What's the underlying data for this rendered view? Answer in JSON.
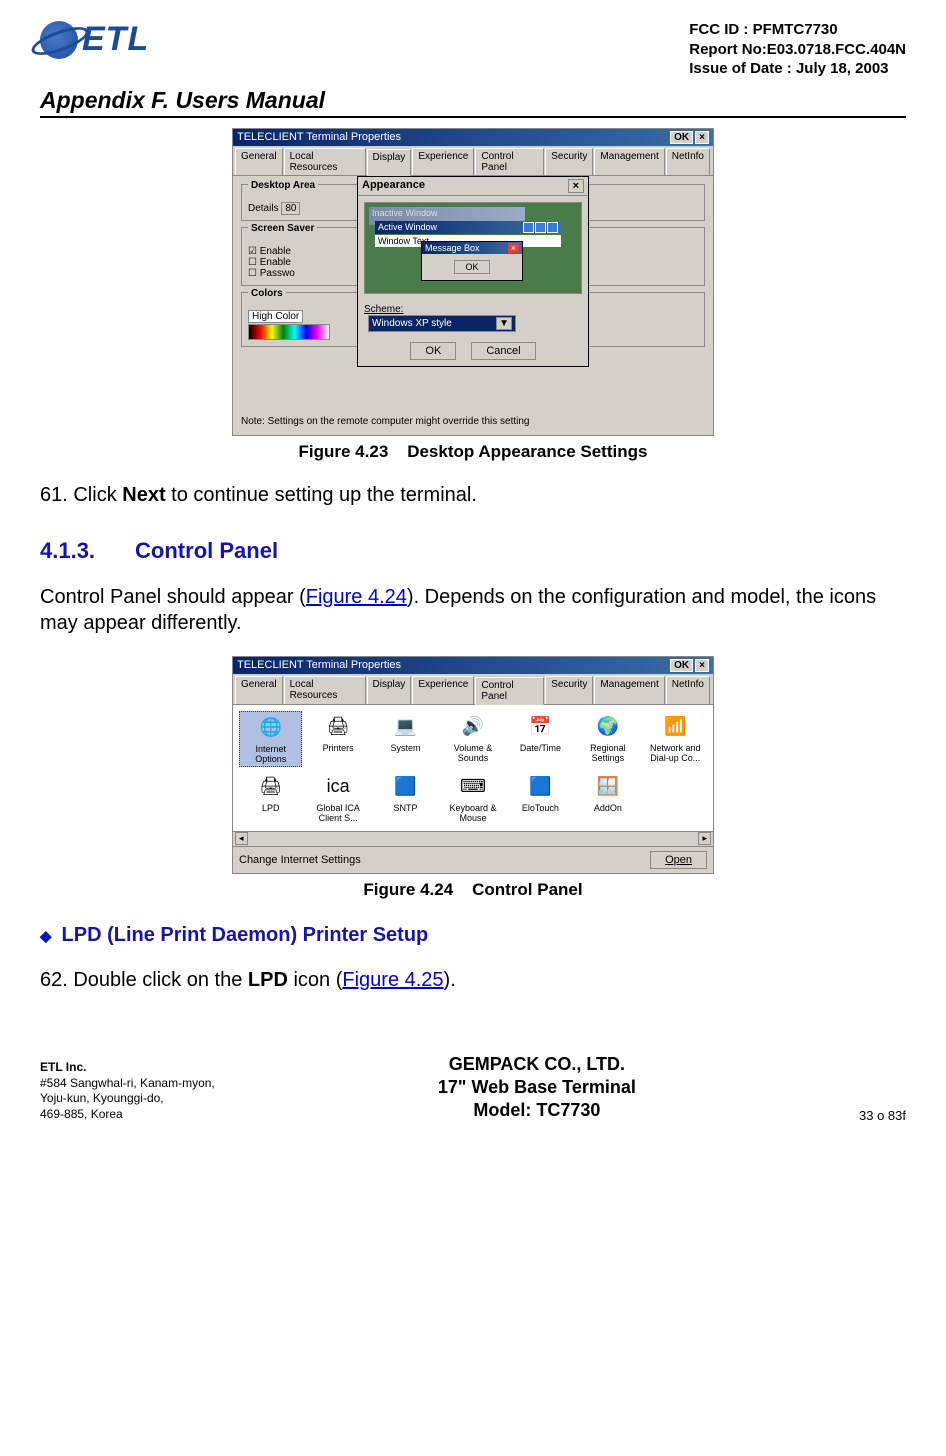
{
  "header": {
    "logo_text": "ETL",
    "meta_line1": "FCC ID : PFMTC7730",
    "meta_line2": "Report No:E03.0718.FCC.404N",
    "meta_line3": "Issue of Date : July 18, 2003",
    "doc_title": "Appendix F.  Users Manual"
  },
  "fig1": {
    "window_title": "TELECLIENT Terminal Properties",
    "ok": "OK",
    "x": "×",
    "tabs": [
      "General",
      "Local Resources",
      "Display",
      "Experience",
      "Control Panel",
      "Security",
      "Management",
      "NetInfo"
    ],
    "active_tab_index": 2,
    "desktop_area_label": "Desktop Area",
    "details_label": "Details",
    "screen_saver_label": "Screen Saver",
    "enable1": "Enable",
    "enable2": "Enable",
    "passwo": "Passwo",
    "colors_label": "Colors",
    "high_color": "High Color",
    "note": "Note: Settings on the remote computer might override this setting",
    "appearance": {
      "title": "Appearance",
      "inactive": "Inactive Window",
      "active": "Active Window",
      "window_text": "Window Text",
      "message_box": "Message Box",
      "ok": "OK",
      "scheme_label": "Scheme:",
      "scheme_value": "Windows XP style",
      "btn_ok": "OK",
      "btn_cancel": "Cancel"
    },
    "caption_no": "Figure 4.23",
    "caption_text": "Desktop Appearance Settings"
  },
  "line61_pre": "61. Click ",
  "line61_bold": "Next",
  "line61_post": " to continue setting up the terminal.",
  "section_413_num": "4.1.3.",
  "section_413_title": "Control Panel",
  "para_cp_1": "Control Panel should appear (",
  "para_cp_link": "Figure 4.24",
  "para_cp_2": ").  Depends on the configuration and model, the icons may appear differently.",
  "fig2": {
    "window_title": "TELECLIENT Terminal Properties",
    "ok": "OK",
    "x": "×",
    "tabs": [
      "General",
      "Local Resources",
      "Display",
      "Experience",
      "Control Panel",
      "Security",
      "Management",
      "NetInfo"
    ],
    "active_tab_index": 4,
    "icons": [
      {
        "glyph": "🌐",
        "label": "Internet Options",
        "selected": true
      },
      {
        "glyph": "🖨",
        "label": "Printers"
      },
      {
        "glyph": "💻",
        "label": "System"
      },
      {
        "glyph": "🔊",
        "label": "Volume & Sounds"
      },
      {
        "glyph": "📅",
        "label": "Date/Time"
      },
      {
        "glyph": "🌍",
        "label": "Regional Settings"
      },
      {
        "glyph": "📶",
        "label": "Network and Dial-up Co..."
      },
      {
        "glyph": "🖨",
        "label": "LPD"
      },
      {
        "glyph": "ica",
        "label": "Global ICA Client S..."
      },
      {
        "glyph": "🟦",
        "label": "SNTP"
      },
      {
        "glyph": "⌨",
        "label": "Keyboard & Mouse"
      },
      {
        "glyph": "🟦",
        "label": "EloTouch"
      },
      {
        "glyph": "🪟",
        "label": "AddOn"
      }
    ],
    "status": "Change Internet Settings",
    "open": "Open",
    "caption_no": "Figure 4.24",
    "caption_text": "Control Panel"
  },
  "lpd_head": "LPD (Line Print Daemon) Printer Setup",
  "line62_pre": "62. Double click on the ",
  "line62_bold": "LPD",
  "line62_mid": " icon (",
  "line62_link": "Figure 4.25",
  "line62_post": ").",
  "footer": {
    "left_bold": "ETL Inc.",
    "left_l2": "#584 Sangwhal-ri, Kanam-myon,",
    "left_l3": "Yoju-kun, Kyounggi-do,",
    "left_l4": " 469-885, Korea",
    "center_l1": "GEMPACK CO., LTD.",
    "center_l2": "17\" Web Base Terminal",
    "center_l3": "Model: TC7730",
    "right": "33 o 83f"
  }
}
